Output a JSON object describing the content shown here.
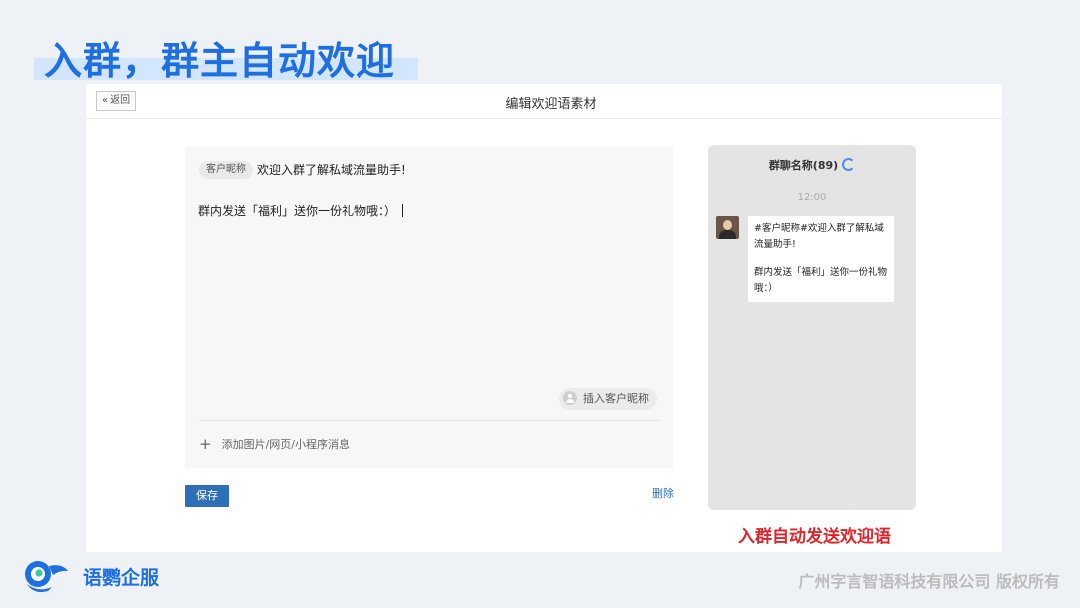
{
  "slide": {
    "title": "入群，群主自动欢迎",
    "caption": "入群自动发送欢迎语",
    "brand": "语鹦企服",
    "copyright": "广州字言智语科技有限公司 版权所有"
  },
  "colors": {
    "accent": "#1f6fe0",
    "title_highlight": "#d3e6ff",
    "save_button": "#2f6fb8",
    "caption": "#e0232a"
  },
  "header": {
    "back_label": "返回",
    "back_icon": "double-chevron-left-icon",
    "title": "编辑欢迎语素材"
  },
  "editor": {
    "nickname_tag": "客户昵称",
    "line1": "欢迎入群了解私域流量助手!",
    "line2": "群内发送「福利」送你一份礼物哦：）",
    "insert_nickname_label": "插入客户昵称",
    "add_media_label": "添加图片/网页/小程序消息"
  },
  "actions": {
    "save_label": "保存",
    "delete_label": "删除"
  },
  "preview": {
    "group_name": "群聊名称(89)",
    "time": "12:00",
    "message_line1": "#客户昵称#欢迎入群了解私域流量助手!",
    "message_line2": "群内发送「福利」送你一份礼物哦：）"
  }
}
